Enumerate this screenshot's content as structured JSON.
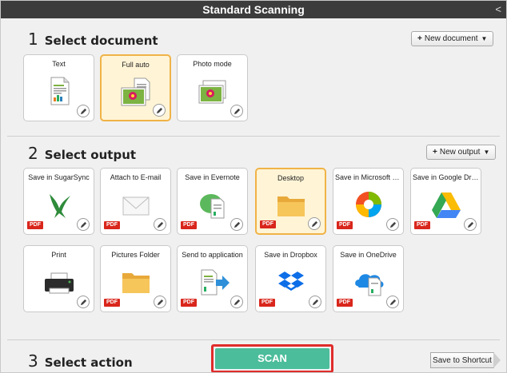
{
  "window": {
    "title": "Standard Scanning",
    "back_glyph": "<"
  },
  "section1": {
    "number": "1",
    "title": "Select document",
    "new_button": "New document"
  },
  "section2": {
    "number": "2",
    "title": "Select output",
    "new_button": "New output"
  },
  "section3": {
    "number": "3",
    "title": "Select action"
  },
  "documents": [
    {
      "label": "Text",
      "icon": "text-document-icon",
      "selected": false
    },
    {
      "label": "Full auto",
      "icon": "full-auto-icon",
      "selected": true
    },
    {
      "label": "Photo mode",
      "icon": "photo-mode-icon",
      "selected": false
    }
  ],
  "outputs": [
    {
      "label": "Save in SugarSync",
      "icon": "sugarsync-icon",
      "pdf": "PDF",
      "selected": false
    },
    {
      "label": "Attach to E-mail",
      "icon": "email-icon",
      "pdf": "PDF",
      "selected": false
    },
    {
      "label": "Save in Evernote",
      "icon": "evernote-icon",
      "pdf": "PDF",
      "selected": false
    },
    {
      "label": "Desktop",
      "icon": "desktop-folder-icon",
      "pdf": "PDF",
      "selected": true
    },
    {
      "label": "Save in Microsoft S...",
      "icon": "microsoft-sharepoint-icon",
      "pdf": "PDF",
      "selected": false
    },
    {
      "label": "Save in Google Dri...",
      "icon": "google-drive-icon",
      "pdf": "PDF",
      "selected": false
    },
    {
      "label": "Print",
      "icon": "printer-icon",
      "pdf": "",
      "selected": false
    },
    {
      "label": "Pictures Folder",
      "icon": "pictures-folder-icon",
      "pdf": "PDF",
      "selected": false
    },
    {
      "label": "Send to application",
      "icon": "send-to-application-icon",
      "pdf": "PDF",
      "selected": false
    },
    {
      "label": "Save in Dropbox",
      "icon": "dropbox-icon",
      "pdf": "PDF",
      "selected": false
    },
    {
      "label": "Save in OneDrive",
      "icon": "onedrive-icon",
      "pdf": "PDF",
      "selected": false
    }
  ],
  "actions": {
    "scan_label": "SCAN",
    "shortcut_label": "Save to Shortcut"
  },
  "colors": {
    "selected_fill": "#fff4d6",
    "selected_border": "#f0b347",
    "scan_green": "#4bbd9a",
    "highlight_red": "#e02b2b",
    "pdf_red": "#d9261c"
  }
}
